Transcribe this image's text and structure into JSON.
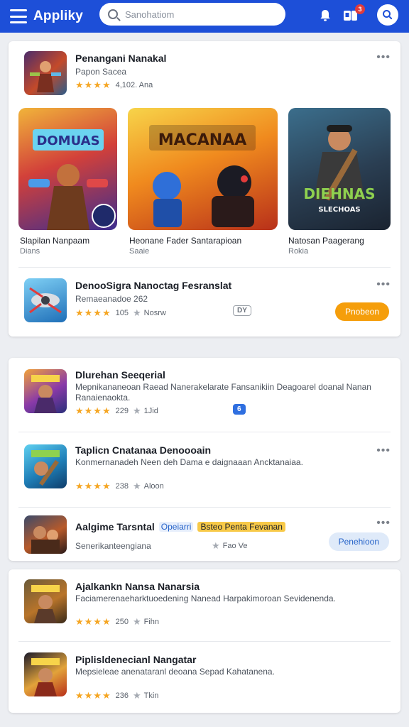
{
  "header": {
    "title": "Appliky",
    "search_placeholder": "Sanohatiom",
    "notifications_count": "3"
  },
  "featured": {
    "top_app": {
      "name": "Penangani Nanakal",
      "subtitle": "Papon Sacea",
      "stars": "★★★★",
      "rating_text": "4,102. Ana"
    },
    "tiles": [
      {
        "art_text": "DOMUAS",
        "title": "Slapilan Nanpaam",
        "subtitle": "Dians"
      },
      {
        "art_text": "MACANAA",
        "title": "Heonane Fader Santarapioan",
        "subtitle": "Saaie"
      },
      {
        "art_text": "DIEHNAS",
        "art_text2": "SLECHOAS",
        "title": "Natosan Paagerang",
        "subtitle": "Rokia"
      }
    ],
    "bottom_app": {
      "name": "DenooSigra Nanoctag Fesranslat",
      "subtitle": "Remaeanadoe 262",
      "stars": "★★★★",
      "rating_num": "105",
      "downloads": "Nosrw",
      "tag": "DY",
      "button": "Pnobeon"
    }
  },
  "list": {
    "items": [
      {
        "name": "Dlurehan Seeqerial",
        "desc": "Mepnikananeoan Raead Nanerakelarate Fansanikiin Deagoarel doanal Nanan Ranaienaokta.",
        "stars": "★★★★",
        "rating_num": "229",
        "downloads": "1Jid",
        "tag": "6"
      },
      {
        "name": "Taplicn Cnatanaa Denoooain",
        "desc": "Konmernanadeh Neen deh Dama e daignaaan Ancktanaiaa.",
        "stars": "★★★★",
        "rating_num": "238",
        "downloads": "Aloon"
      },
      {
        "name": "Aalgime Tarsntal",
        "badge_blue": "Opeiarri",
        "badge_yellow": "Bsteo Penta Fevanan",
        "subtitle": "Senerikanteengiana",
        "downloads": "Fao Ve",
        "button": "Penehioon"
      }
    ]
  },
  "list2": {
    "items": [
      {
        "name": "Ajalkankn Nansa Nanarsia",
        "desc": "Faciamerenaeharktuoedening Nanead Harpakimoroan Sevidenenda.",
        "stars": "★★★★",
        "rating_num": "250",
        "downloads": "Fihn"
      },
      {
        "name": "Piplisldenecianl Nangatar",
        "desc": "Mepsieleae anenataranl deoana Sepad Kahatanena.",
        "stars": "★★★★",
        "rating_num": "236",
        "downloads": "Tkin"
      }
    ]
  },
  "colors": {
    "brand": "#1d4fd8",
    "accent_orange": "#f59e0b",
    "star": "#f5a623"
  }
}
